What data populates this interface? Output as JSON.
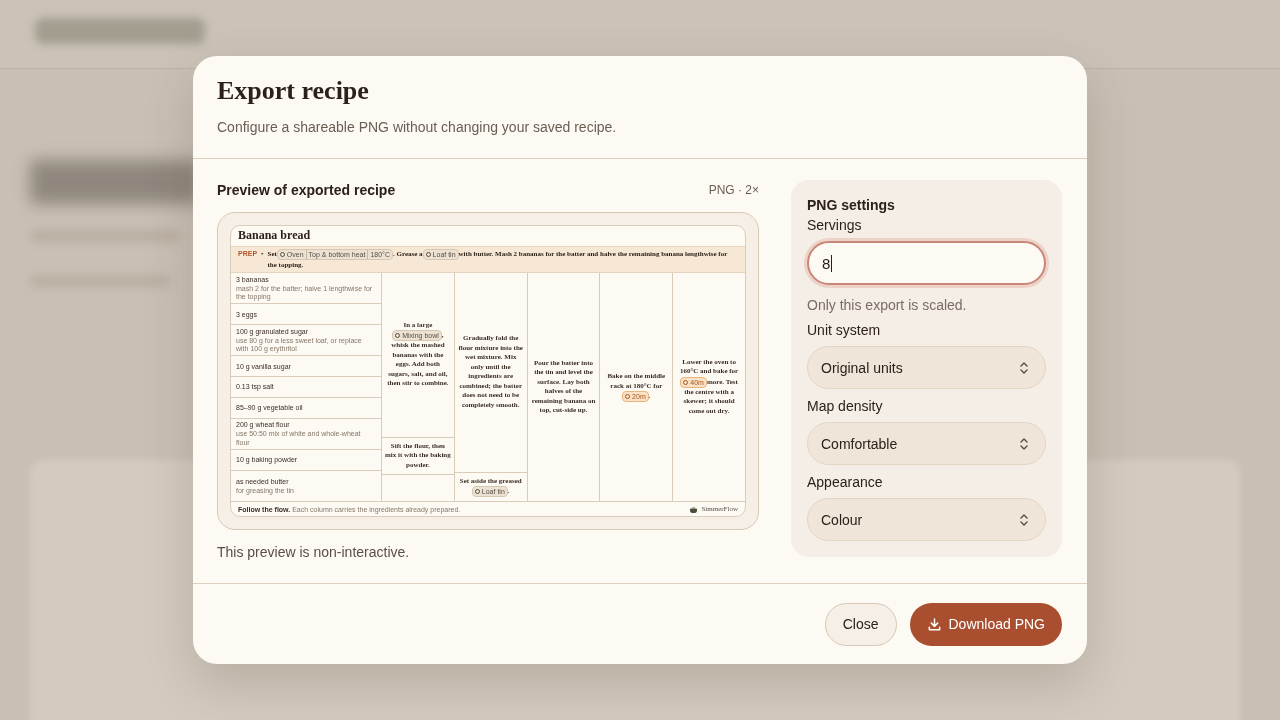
{
  "dialog": {
    "title": "Export recipe",
    "subtitle": "Configure a shareable PNG without changing your saved recipe."
  },
  "preview": {
    "heading": "Preview of exported recipe",
    "format": "PNG · 2×",
    "note": "This preview is non-interactive.",
    "recipe": {
      "title": "Banana bread",
      "prep": {
        "label": "PREP",
        "bullet": "•",
        "parts": [
          {
            "kind": "text",
            "text": "Set"
          },
          {
            "kind": "tool",
            "items": [
              "Oven",
              "Top & bottom heat",
              "180°C"
            ]
          },
          {
            "kind": "text",
            "text": ". Grease a"
          },
          {
            "kind": "tool",
            "items": [
              "Loaf tin"
            ]
          },
          {
            "kind": "text",
            "text": "with butter. Mash 2 bananas for the batter and halve the remaining banana lengthwise for the topping."
          }
        ]
      },
      "ingredients": [
        {
          "name": "3 bananas",
          "note": "mash 2 for the batter; halve 1 lengthwise for the topping"
        },
        {
          "name": "3 eggs"
        },
        {
          "name": "100 g granulated sugar",
          "note": "use 80 g for a less sweet loaf, or replace with 100 g erythritol"
        },
        {
          "name": "10 g vanilla sugar"
        },
        {
          "name": "0.13 tsp salt"
        },
        {
          "name": "85–90 g vegetable oil"
        },
        {
          "name": "200 g wheat flour",
          "note": "use 50:50 mix of white and whole-wheat flour"
        },
        {
          "name": "10 g baking powder"
        },
        {
          "name": "as needed butter",
          "note": "for greasing the tin"
        }
      ],
      "steps": [
        {
          "cells": [
            {
              "parts": [
                {
                  "kind": "text",
                  "text": "In a large"
                },
                {
                  "kind": "tool",
                  "items": [
                    "Mixing bowl"
                  ]
                },
                {
                  "kind": "text",
                  "text": ", whisk the mashed bananas with the eggs. Add both sugars, salt, and oil, then stir to combine."
                }
              ]
            },
            {
              "parts": [
                {
                  "kind": "text",
                  "text": "Sift the flour, then mix it with the baking powder."
                }
              ]
            },
            {}
          ]
        },
        {
          "cells": [
            {
              "parts": [
                {
                  "kind": "text",
                  "text": "Gradually fold the flour mixture into the wet mixture. Mix only until the ingredients are combined; the batter does not need to be completely smooth."
                }
              ]
            },
            {
              "parts": [
                {
                  "kind": "text",
                  "text": "Set aside the greased"
                },
                {
                  "kind": "tool",
                  "items": [
                    "Loaf tin"
                  ]
                },
                {
                  "kind": "text",
                  "text": "."
                }
              ]
            }
          ]
        },
        {
          "cells": [
            {
              "parts": [
                {
                  "kind": "text",
                  "text": "Pour the batter into the tin and level the surface. Lay both halves of the remaining banana on top, cut-side up."
                }
              ]
            }
          ]
        },
        {
          "cells": [
            {
              "parts": [
                {
                  "kind": "text",
                  "text": "Bake on the middle rack at 180°C for"
                },
                {
                  "kind": "timer",
                  "items": [
                    "20m"
                  ]
                },
                {
                  "kind": "text",
                  "text": "."
                }
              ]
            }
          ]
        },
        {
          "cells": [
            {
              "parts": [
                {
                  "kind": "text",
                  "text": "Lower the oven to 160°C and bake for"
                },
                {
                  "kind": "timer",
                  "items": [
                    "40m"
                  ]
                },
                {
                  "kind": "text",
                  "text": "more. Test the centre with a skewer; it should come out dry."
                }
              ]
            }
          ]
        }
      ],
      "footer": {
        "lead": "Follow the flow.",
        "text": "Each column carries the ingredients already prepared.",
        "brand": "SimmerFlow"
      }
    }
  },
  "settings": {
    "title": "PNG settings",
    "servings": {
      "label": "Servings",
      "value": "8",
      "focused": true,
      "hint": "Only this export is scaled."
    },
    "selects": [
      {
        "label": "Unit system",
        "value": "Original units"
      },
      {
        "label": "Map density",
        "value": "Comfortable"
      },
      {
        "label": "Appearance",
        "value": "Colour"
      }
    ]
  },
  "buttons": [
    {
      "label": "Close",
      "kind": "secondary"
    },
    {
      "label": "Download PNG",
      "kind": "primary"
    }
  ]
}
